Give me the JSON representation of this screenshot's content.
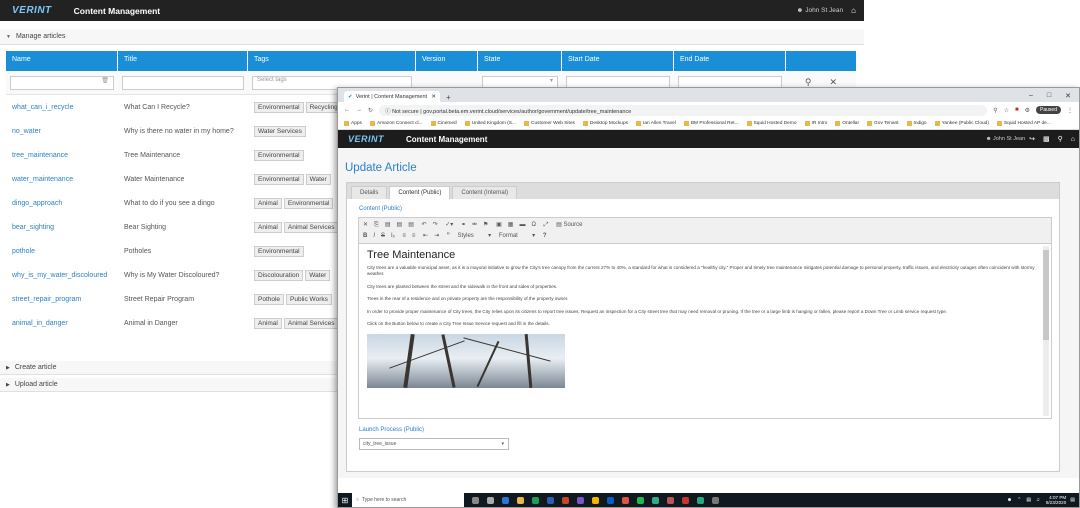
{
  "back": {
    "logo": "VERINT",
    "app_title": "Content Management",
    "user": "John St Jean",
    "manage_label": "Manage articles",
    "columns": [
      "Name",
      "Title",
      "Tags",
      "Version",
      "State",
      "Start Date",
      "End Date"
    ],
    "tags_placeholder": "Select tags",
    "rows": [
      {
        "name": "what_can_i_recycle",
        "title": "What Can I Recycle?",
        "tags": [
          "Environmental",
          "Recycling"
        ]
      },
      {
        "name": "no_water",
        "title": "Why is there no water in my home?",
        "tags": [
          "Water Services"
        ]
      },
      {
        "name": "tree_maintenance",
        "title": "Tree Maintenance",
        "tags": [
          "Environmental"
        ]
      },
      {
        "name": "water_maintenance",
        "title": "Water Maintenance",
        "tags": [
          "Environmental",
          "Water"
        ]
      },
      {
        "name": "dingo_approach",
        "title": "What to do if you see a dingo",
        "tags": [
          "Animal",
          "Environmental"
        ]
      },
      {
        "name": "bear_sighting",
        "title": "Bear Sighting",
        "tags": [
          "Animal",
          "Animal Services"
        ]
      },
      {
        "name": "pothole",
        "title": "Potholes",
        "tags": [
          "Environmental"
        ]
      },
      {
        "name": "why_is_my_water_discoloured",
        "title": "Why is My Water Discoloured?",
        "tags": [
          "Discolouration",
          "Water"
        ]
      },
      {
        "name": "street_repair_program",
        "title": "Street Repair Program",
        "tags": [
          "Pothole",
          "Public Works"
        ]
      },
      {
        "name": "animal_in_danger",
        "title": "Animal in Danger",
        "tags": [
          "Animal",
          "Animal Services"
        ]
      }
    ],
    "create_label": "Create article",
    "upload_label": "Upload article"
  },
  "browser": {
    "tab_title": "Verint | Content Management",
    "not_secure": "Not secure",
    "url": "gov.portal.beta.em.verint.cloud/services/author/government/update/tree_maintenance",
    "bookmarks": [
      "Apps",
      "Amazon Connect cl...",
      "Cinemed",
      "United Kingdom (S...",
      "Customer Web Sites",
      "Desktop Mockups",
      "Ian Allen Travel",
      "BM Professional Ret...",
      "Squid Hosted Demo",
      "IR Intro",
      "Ontellar",
      "Gov Tenant",
      "Indigo",
      "Yankee (Public Cloud)",
      "Squid Hosted AP de..."
    ],
    "profile": "Paused"
  },
  "front": {
    "logo": "VERINT",
    "app_title": "Content Management",
    "user": "John St Jean",
    "heading": "Update Article",
    "tabs": [
      "Details",
      "Content (Public)",
      "Content (Internal)"
    ],
    "content_label": "Content (Public)",
    "toolbar_source": "Source",
    "toolbar_styles": "Styles",
    "toolbar_format": "Format",
    "article_title": "Tree Maintenance",
    "paragraphs": [
      "City trees are a valuable municipal asset, as it is a mayoral initiative to grow the City's tree canopy from the current 27% to 40%, a standard for what is considered a \"healthy city.\" Proper and timely tree maintenance mitigates potential damage to personal property, traffic issues, and electricity outages often coincident with stormy weather.",
      "City trees are planted between the street and the sidewalk in the front and sides of properties.",
      "Trees in the rear of a residence and on private property are the responsibility of the property owner.",
      "In order to provide proper maintenance of City trees, the City relies upon its citizens to report tree issues. Request an inspection for a City street tree that may need removal or pruning. If the tree or a large limb is hanging or fallen, please report a Down Tree or Limb service request type.",
      "Click on the Button below to create a City Tree Issue Service request and fill in the details."
    ],
    "launch_label": "Launch Process (Public)",
    "launch_value": "city_tree_issue"
  },
  "taskbar": {
    "search": "Type here to search",
    "time": "4:07 PM",
    "date": "8/23/2020"
  }
}
